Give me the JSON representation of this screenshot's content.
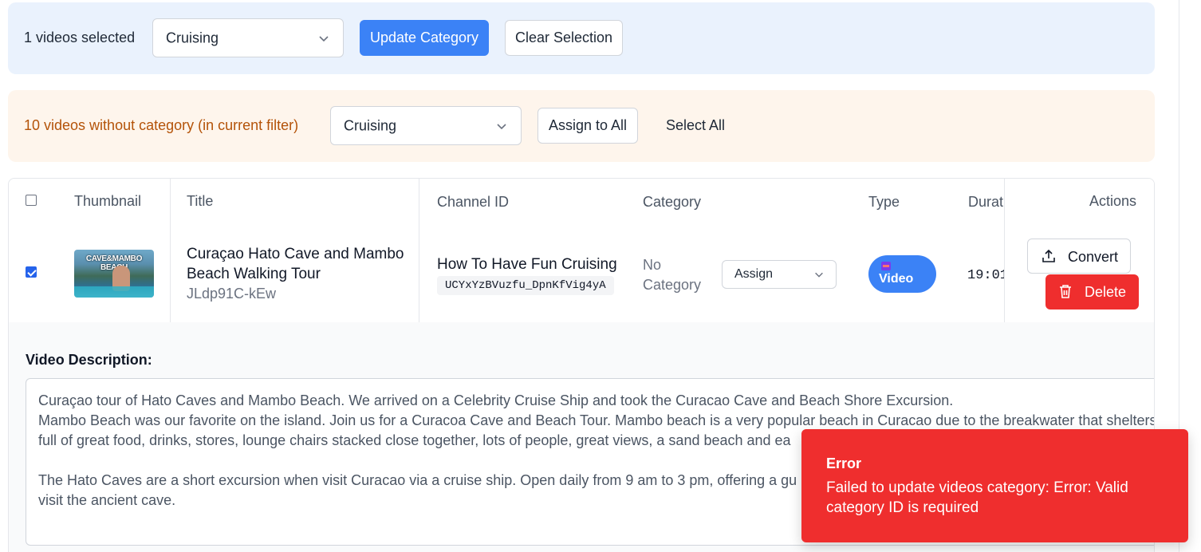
{
  "bulk_bar": {
    "count_text": "1 videos selected",
    "category_select": "Cruising",
    "update_button": "Update Category",
    "clear_button": "Clear Selection"
  },
  "uncategorized_bar": {
    "text": "10 videos without category (in current filter)",
    "category_select": "Cruising",
    "assign_all_button": "Assign to All",
    "select_all_link": "Select All"
  },
  "table": {
    "headers": {
      "thumbnail": "Thumbnail",
      "title": "Title",
      "channel_id": "Channel ID",
      "category": "Category",
      "type": "Type",
      "duration": "Durat",
      "actions": "Actions"
    },
    "row": {
      "selected": true,
      "thumbnail_text": "CAVE&MAMBO BEACH",
      "title": "Curaçao Hato Cave and Mambo Beach Walking Tour",
      "video_id": "JLdp91C-kEw",
      "channel_name": "How To Have Fun Cruising",
      "channel_id": "UCYxYzBVuzfu_DpnKfVig4yA",
      "category": "No Category",
      "assign_select": "Assign",
      "type": "Video",
      "duration": "19:01",
      "convert_button": "Convert",
      "delete_button": "Delete"
    }
  },
  "description": {
    "label": "Video Description:",
    "lines": [
      "Curaçao tour of Hato Caves and Mambo Beach. We arrived on a Celebrity Cruise Ship and took the Curacao Cave and Beach Shore Excursion.",
      "Mambo Beach was our favorite on the island. Join us for a Curacoa Cave and Beach Tour. Mambo beach is a very popular beach in Curacao due to the breakwater that shelters",
      "full of great food, drinks, stores, lounge chairs stacked close together, lots of people, great views, a sand beach and ea",
      "",
      "The Hato Caves are a short excursion when visit Curacao via a cruise ship. Open daily from 9 am to 3 pm, offering a gu",
      "visit the ancient cave."
    ]
  },
  "toast": {
    "title": "Error",
    "message": "Failed to update videos category: Error: Valid category ID is required"
  },
  "colors": {
    "primary": "#3b82f6",
    "danger": "#ef2e2e",
    "warning_text": "#b45309"
  }
}
